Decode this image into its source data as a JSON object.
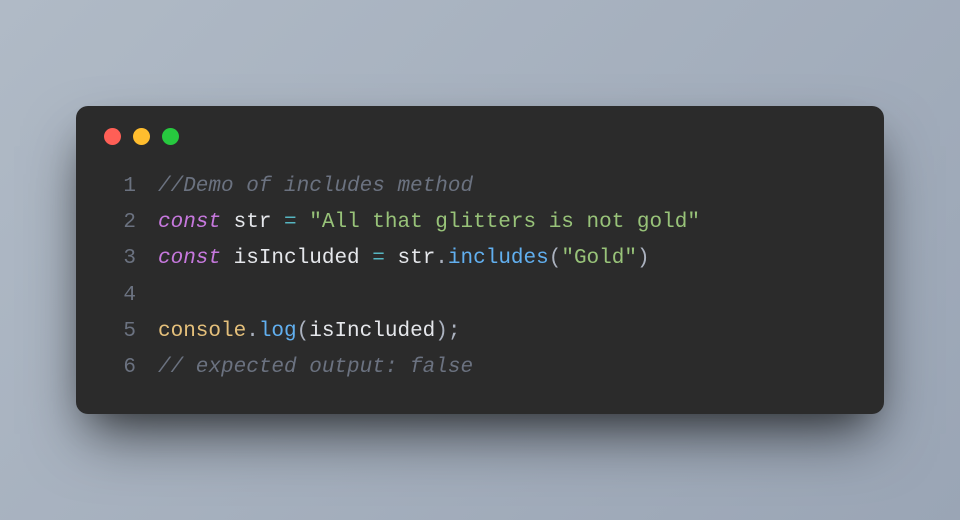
{
  "window": {
    "traffic_lights": [
      "#ff5f56",
      "#ffbd2e",
      "#27c93f"
    ]
  },
  "code": {
    "language": "javascript",
    "lines": [
      {
        "n": "1",
        "tokens": [
          {
            "t": "//Demo of includes method",
            "c": "comment"
          }
        ]
      },
      {
        "n": "2",
        "tokens": [
          {
            "t": "const",
            "c": "keyword"
          },
          {
            "t": " ",
            "c": "ident"
          },
          {
            "t": "str",
            "c": "ident"
          },
          {
            "t": " ",
            "c": "ident"
          },
          {
            "t": "=",
            "c": "op"
          },
          {
            "t": " ",
            "c": "ident"
          },
          {
            "t": "\"All that glitters is not gold\"",
            "c": "string"
          }
        ]
      },
      {
        "n": "3",
        "tokens": [
          {
            "t": "const",
            "c": "keyword"
          },
          {
            "t": " ",
            "c": "ident"
          },
          {
            "t": "isIncluded",
            "c": "ident"
          },
          {
            "t": " ",
            "c": "ident"
          },
          {
            "t": "=",
            "c": "op"
          },
          {
            "t": " ",
            "c": "ident"
          },
          {
            "t": "str",
            "c": "ident"
          },
          {
            "t": ".",
            "c": "punct"
          },
          {
            "t": "includes",
            "c": "func"
          },
          {
            "t": "(",
            "c": "punct"
          },
          {
            "t": "\"Gold\"",
            "c": "string"
          },
          {
            "t": ")",
            "c": "punct"
          }
        ]
      },
      {
        "n": "4",
        "tokens": []
      },
      {
        "n": "5",
        "tokens": [
          {
            "t": "console",
            "c": "obj"
          },
          {
            "t": ".",
            "c": "punct"
          },
          {
            "t": "log",
            "c": "func"
          },
          {
            "t": "(",
            "c": "punct"
          },
          {
            "t": "isIncluded",
            "c": "ident"
          },
          {
            "t": ")",
            "c": "punct"
          },
          {
            "t": ";",
            "c": "punct"
          }
        ]
      },
      {
        "n": "6",
        "tokens": [
          {
            "t": "// expected output: false",
            "c": "comment"
          }
        ]
      }
    ]
  }
}
